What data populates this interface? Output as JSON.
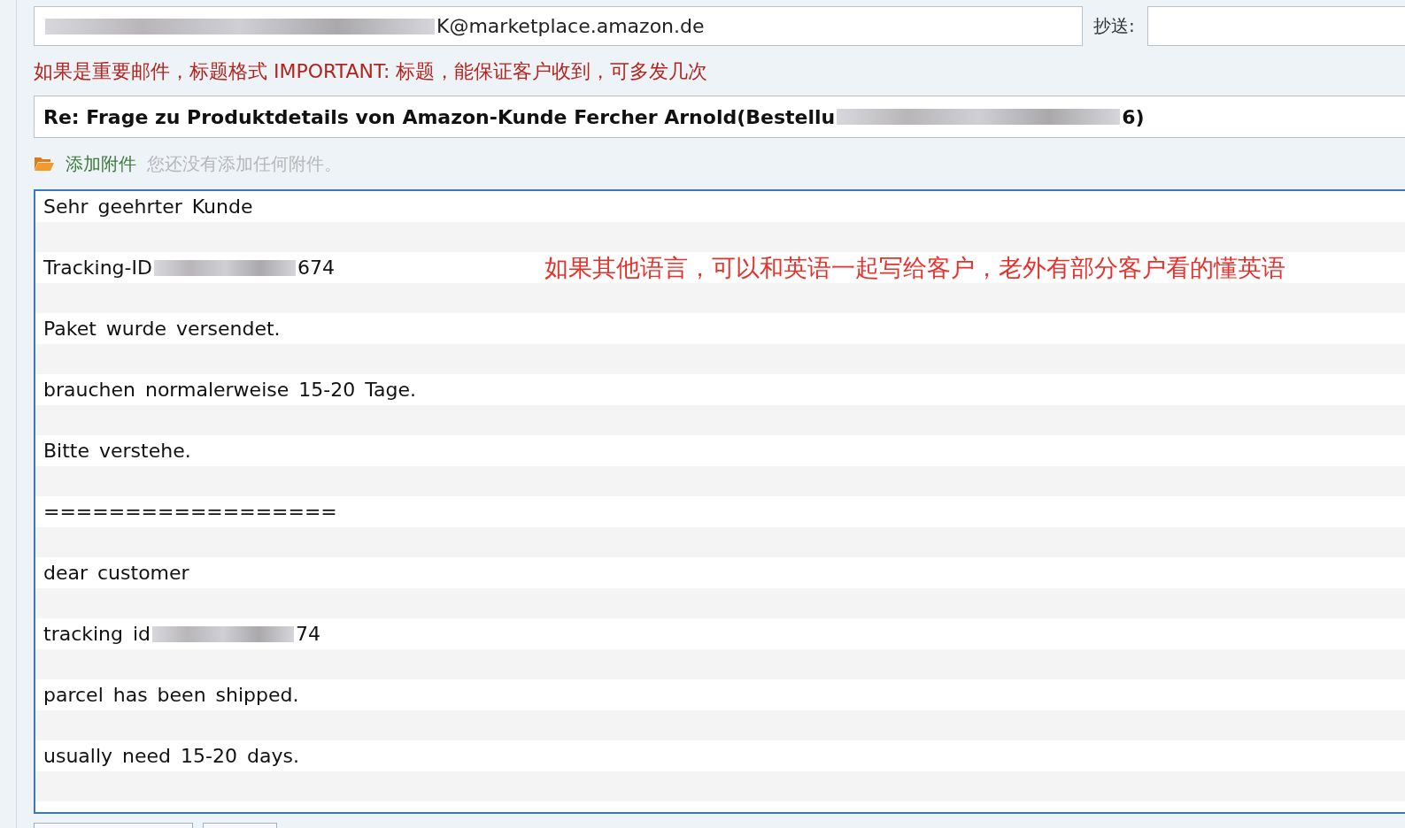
{
  "recipient": {
    "segments": [
      "K@marketplace.amazon.de"
    ]
  },
  "cc": {
    "label": "抄送:"
  },
  "hint": "如果是重要邮件，标题格式 IMPORTANT: 标题，能保证客户收到，可多发几次",
  "subject": {
    "segments": [
      "Re: Frage zu Produktdetails von Amazon-Kunde Fercher Arnold(Bestellu",
      "6)"
    ]
  },
  "attachment": {
    "label": "添加附件",
    "note": "您还没有添加任何附件。"
  },
  "body": {
    "lines": [
      {
        "segments": [
          "Sehr geehrter Kunde"
        ]
      },
      {
        "segments": [
          "Tracking-ID",
          "674"
        ],
        "note": "如果其他语言，可以和英语一起写给客户，老外有部分客户看的懂英语"
      },
      {
        "segments": [
          "Paket wurde versendet."
        ]
      },
      {
        "segments": [
          "brauchen normalerweise 15-20 Tage."
        ]
      },
      {
        "segments": [
          "Bitte verstehe."
        ]
      },
      {
        "segments": [
          "=================="
        ]
      },
      {
        "segments": [
          "dear customer"
        ]
      },
      {
        "segments": [
          "tracking id",
          "74"
        ]
      },
      {
        "segments": [
          "parcel has been shipped."
        ]
      },
      {
        "segments": [
          "usually need 15-20 days."
        ]
      }
    ]
  }
}
